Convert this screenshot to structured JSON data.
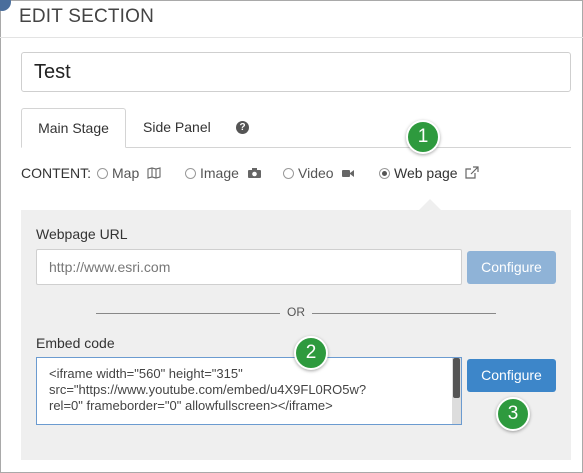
{
  "colors": {
    "accent": "#3d86c9",
    "accent_disabled": "#8fb3d7",
    "badge": "#2e9a3e",
    "panel_bg": "#efefef"
  },
  "dialog": {
    "title": "EDIT SECTION",
    "section_name": "Test"
  },
  "tabs": [
    {
      "label": "Main Stage",
      "active": true
    },
    {
      "label": "Side Panel",
      "active": false
    }
  ],
  "help_icon": "?",
  "content": {
    "label": "CONTENT:",
    "options": [
      {
        "label": "Map",
        "icon": "map-icon",
        "checked": false
      },
      {
        "label": "Image",
        "icon": "camera-icon",
        "checked": false
      },
      {
        "label": "Video",
        "icon": "video-camera-icon",
        "checked": false
      },
      {
        "label": "Web page",
        "icon": "external-link-icon",
        "checked": true
      }
    ]
  },
  "webpage": {
    "url_label": "Webpage URL",
    "url_placeholder": "http://www.esri.com",
    "configure_label": "Configure",
    "or_text": "OR",
    "embed_label": "Embed code",
    "embed_lines": [
      "<iframe width=\"560\" height=\"315\"",
      "src=\"https://www.youtube.com/embed/u4X9FL0RO5w?",
      "rel=0\" frameborder=\"0\" allowfullscreen></iframe>"
    ],
    "embed_configure_label": "Configure"
  },
  "badges": [
    "1",
    "2",
    "3"
  ]
}
